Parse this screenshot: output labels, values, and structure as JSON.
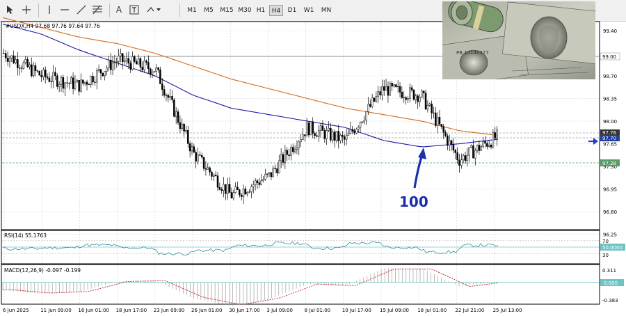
{
  "toolbar": {
    "tools": [
      "cursor-tool",
      "crosshair-tool",
      "vertical-line-tool",
      "horizontal-line-tool",
      "trendline-tool",
      "fibo-tool",
      "text-tool",
      "text-label-tool",
      "shapes-tool"
    ],
    "timeframes": [
      "M1",
      "M5",
      "M15",
      "M30",
      "H1",
      "H4",
      "D1",
      "W1",
      "MN"
    ],
    "active_timeframe": "H4"
  },
  "main_panel": {
    "header": "#USDX,H4  97.68 97.76 97.64 97.76",
    "price_labels": [
      "99.40",
      "99.00",
      "98.70",
      "98.35",
      "98.00",
      "97.65",
      "97.30",
      "96.95",
      "96.60",
      "96.25"
    ],
    "current_price_tag": "97.76",
    "level_tags": [
      "97.70",
      "97.28"
    ],
    "level_99": "99.00",
    "annotation": "100"
  },
  "rsi_panel": {
    "header": "RSI(14) 55.1763",
    "labels": [
      "70",
      "30"
    ],
    "value_tag": "50.0000"
  },
  "macd_panel": {
    "header": "MACD(12,26,9) -0.097 -0.199",
    "labels": [
      "0.311",
      "-0.383"
    ],
    "value_tag": "0.000"
  },
  "time_axis": [
    "6 Jun 2025",
    "11 Jun 09:00",
    "16 Jun 01:00",
    "18 Jun 17:00",
    "23 Jun 09:00",
    "26 Jun 01:00",
    "30 Jun 17:00",
    "3 Jul 09:00",
    "8 Jul 01:00",
    "10 Jul 17:00",
    "15 Jul 09:00",
    "18 Jul 01:00",
    "22 Jul 21:00",
    "25 Jul 13:00"
  ],
  "colors": {
    "ma_fast": "#1a1aa0",
    "ma_slow": "#d2691e",
    "candle": "#000000",
    "rsi": "#2e8b9a",
    "macd_hist": "#a8a8a8",
    "macd_signal": "#c02020",
    "annotation": "#1a2faa",
    "level": "#5a9a6a"
  },
  "chart_data": {
    "type": "line",
    "symbol": "#USDX",
    "timeframe": "H4",
    "ohlc_last": {
      "open": 97.68,
      "high": 97.76,
      "low": 97.64,
      "close": 97.76
    },
    "ylim": [
      96.25,
      99.4
    ],
    "x": [
      "6 Jun 2025",
      "11 Jun 09:00",
      "16 Jun 01:00",
      "18 Jun 17:00",
      "23 Jun 09:00",
      "26 Jun 01:00",
      "30 Jun 17:00",
      "3 Jul 09:00",
      "8 Jul 01:00",
      "10 Jul 17:00",
      "15 Jul 09:00",
      "18 Jul 01:00",
      "22 Jul 21:00",
      "25 Jul 13:00"
    ],
    "series": [
      {
        "values": [
          99.05,
          98.7,
          98.55,
          98.95,
          98.8,
          97.5,
          96.85,
          97.15,
          97.9,
          97.7,
          98.5,
          98.4,
          97.4,
          97.76
        ]
      },
      {
        "values": [
          99.5,
          99.35,
          99.1,
          98.9,
          98.7,
          98.4,
          98.2,
          98.1,
          98.0,
          97.9,
          97.7,
          97.6,
          97.65,
          97.72
        ]
      },
      {
        "values": [
          99.6,
          99.45,
          99.3,
          99.2,
          99.05,
          98.85,
          98.65,
          98.5,
          98.35,
          98.2,
          98.1,
          98.0,
          97.85,
          97.78
        ]
      }
    ],
    "rsi": {
      "ylim": [
        0,
        100
      ],
      "levels": [
        70,
        30
      ],
      "last": 55.1763
    },
    "macd": {
      "params": "12,26,9",
      "main": -0.097,
      "signal": -0.199,
      "ylim": [
        -0.383,
        0.311
      ]
    }
  }
}
